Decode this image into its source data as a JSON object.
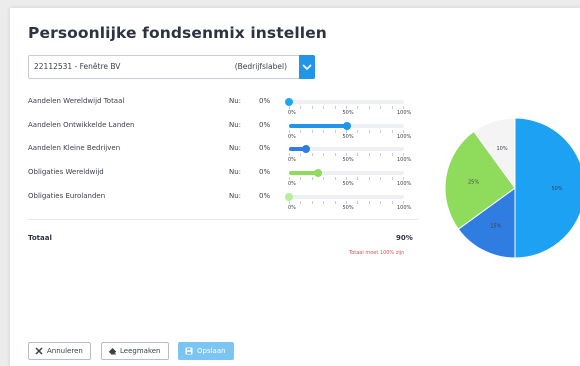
{
  "header": {
    "title": "Persoonlijke fondsenmix instellen"
  },
  "account_select": {
    "account": "22112531 - Fenêtre BV",
    "label": "(Bedrijfslabel)"
  },
  "funds": [
    {
      "name": "Aandelen Wereldwijd Totaal",
      "nu_label": "Nu:",
      "nu_value": "0%",
      "slider_percent": 0,
      "color": "#1da9f0"
    },
    {
      "name": "Aandelen Ontwikkelde Landen",
      "nu_label": "Nu:",
      "nu_value": "0%",
      "slider_percent": 50,
      "color": "#2196e8"
    },
    {
      "name": "Aandelen Kleine Bedrijven",
      "nu_label": "Nu:",
      "nu_value": "0%",
      "slider_percent": 15,
      "color": "#2f7de0"
    },
    {
      "name": "Obligaties Wereldwijd",
      "nu_label": "Nu:",
      "nu_value": "0%",
      "slider_percent": 25,
      "color": "#8fdc5c"
    },
    {
      "name": "Obligaties Eurolanden",
      "nu_label": "Nu:",
      "nu_value": "0%",
      "slider_percent": 0,
      "color": "#b6ee9a"
    }
  ],
  "scale_labels": [
    "0%",
    "50%",
    "100%"
  ],
  "totals": {
    "label": "Totaal",
    "value": "90%",
    "warning": "Totaal moet 100% zijn"
  },
  "buttons": {
    "cancel": "Annuleren",
    "clear": "Leegmaken",
    "save": "Opslaan"
  },
  "chart_data": {
    "type": "pie",
    "slices": [
      {
        "label": "50%",
        "value": 50,
        "color": "#1da1f2"
      },
      {
        "label": "15%",
        "value": 15,
        "color": "#2f7de0"
      },
      {
        "label": "25%",
        "value": 25,
        "color": "#8fdc5c"
      },
      {
        "label": "10%",
        "value": 10,
        "color": "#f4f4f4"
      }
    ]
  }
}
